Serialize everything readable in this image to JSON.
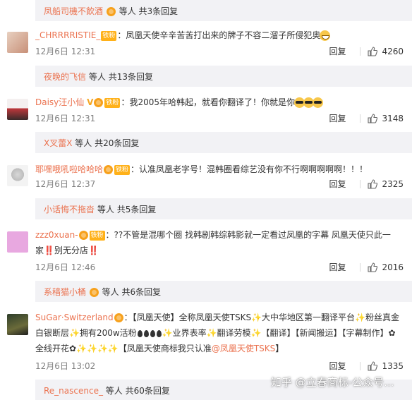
{
  "replies": [
    {
      "user": "凤船司機不飲酒",
      "suffix": "等人",
      "more": "共3条回复"
    },
    {
      "user": "夜晚的飞信",
      "suffix": "等人",
      "more": "共13条回复"
    },
    {
      "user": "X叉蕾X",
      "suffix": "等人",
      "more": "共20条回复"
    },
    {
      "user": "小话悔不拖沓",
      "suffix": "等人",
      "more": "共5条回复"
    },
    {
      "user": "系穑猫小桶",
      "suffix": "等人",
      "more": "共6条回复"
    },
    {
      "user": "Re_nascence_",
      "suffix": "等人",
      "more": "共60条回复"
    }
  ],
  "badge_label": "铁粉",
  "comments": [
    {
      "user": "_CHRRRRISTIE_",
      "text": "：凤凰天使辛辛苦苦打出来的牌子不容二溜子所侵犯奥",
      "time": "12月6日 12:31",
      "reply": "回复",
      "likes": "4260"
    },
    {
      "user": "Daisy汪小仙",
      "text": "：我2005年哈韩起，就看你翻译了！你就是你",
      "time": "12月6日 12:31",
      "reply": "回复",
      "likes": "3148"
    },
    {
      "user": "耶嘿哦吼啦哈哈哈",
      "text": "：认准凤凰老字号！混韩圈看综艺没有你不行啊啊啊啊啊！！！",
      "time": "12月6日 12:37",
      "reply": "回复",
      "likes": "2325"
    },
    {
      "user": "zzz0xuan-",
      "text": "：??不管是混哪个圈 找韩剧韩综韩影就一定看过凤凰的字幕 凤凰天使只此一家‼️别无分店‼️",
      "time": "12月6日 12:46",
      "reply": "回复",
      "likes": "2016"
    },
    {
      "user": "SuGar·Switzerland",
      "text_a": "：【凤凰天使】全称凤凰天使TSKS✨大中华地区第一翻译平台✨粉丝真金白银断层✨拥有200w活粉",
      "text_b": "✨业界表率✨翻译劳模✨【翻译】【新闻搬运】【字幕制作】✿全线开花✿✨✨✨✨【凤凰天使商标我只认准",
      "link": "@凤凰天使TSKS",
      "text_c": "】",
      "time": "12月6日 13:02",
      "reply": "回复",
      "likes": "1335"
    }
  ],
  "watermark": "知乎 @立春商标-公众号..."
}
